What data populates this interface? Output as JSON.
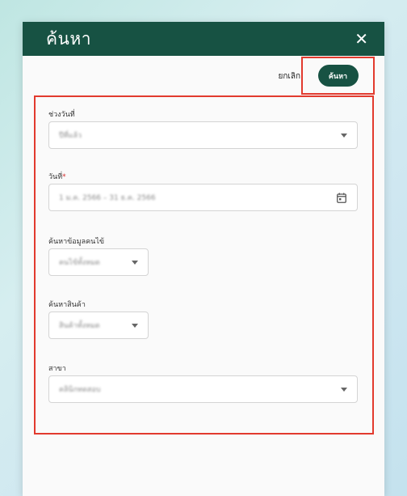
{
  "modal": {
    "title": "ค้นหา",
    "close_icon": "close-icon",
    "close_glyph": "✕"
  },
  "actions": {
    "cancel_label": "ยกเลิก",
    "search_label": "ค้นหา"
  },
  "form": {
    "date_range": {
      "label": "ช่วงวันที่",
      "value": "ปีที่แล้ว"
    },
    "date": {
      "label": "วันที่",
      "required_mark": "*",
      "value": "1 ม.ค. 2566 – 31 ธ.ค. 2566",
      "icon": "calendar-icon"
    },
    "patient_search": {
      "label": "ค้นหาข้อมูลคนไข้",
      "value": "คนไข้ทั้งหมด"
    },
    "product_search": {
      "label": "ค้นหาสินค้า",
      "value": "สินค้าทั้งหมด"
    },
    "branch": {
      "label": "สาขา",
      "value": "คลินิกทดสอบ"
    }
  },
  "colors": {
    "brand": "#175243",
    "highlight": "#e23a2e"
  }
}
